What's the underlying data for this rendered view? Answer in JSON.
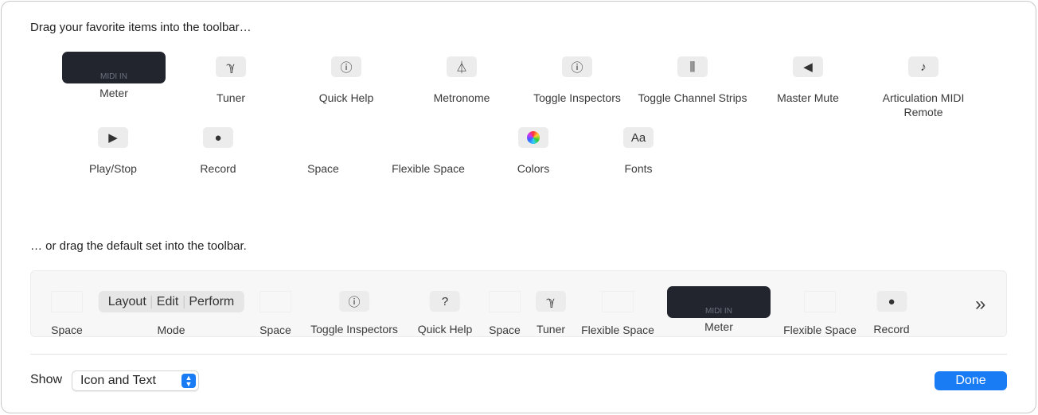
{
  "palette": {
    "heading": "Drag your favorite items into the toolbar…",
    "row1": [
      {
        "label": "Meter",
        "icon": "meter",
        "sub": "MIDI IN"
      },
      {
        "label": "Tuner",
        "icon": "tuning-fork-icon",
        "glyph": "ℽ"
      },
      {
        "label": "Quick Help",
        "icon": "question-circle-icon",
        "glyph": "ⓘ"
      },
      {
        "label": "Metronome",
        "icon": "metronome-icon",
        "glyph": "⏃"
      },
      {
        "label": "Toggle Inspectors",
        "icon": "info-circle-icon",
        "glyph": "ⓘ"
      },
      {
        "label": "Toggle Channel Strips",
        "icon": "sliders-icon",
        "glyph": "⫼"
      },
      {
        "label": "Master Mute",
        "icon": "speaker-icon",
        "glyph": "◀"
      },
      {
        "label": "Articulation MIDI Remote",
        "icon": "articulation-icon",
        "glyph": "♪"
      }
    ],
    "row2": [
      {
        "label": "Play/Stop",
        "icon": "play-icon",
        "glyph": "▶"
      },
      {
        "label": "Record",
        "icon": "record-icon",
        "glyph": "●"
      },
      {
        "label": "Space",
        "icon": "space"
      },
      {
        "label": "Flexible Space",
        "icon": "flexible-space"
      },
      {
        "label": "Colors",
        "icon": "color-wheel-icon"
      },
      {
        "label": "Fonts",
        "icon": "fonts-icon",
        "glyph": "Aa"
      }
    ]
  },
  "default_set": {
    "heading": "… or drag the default set into the toolbar.",
    "items": [
      {
        "label": "Space"
      },
      {
        "label": "Mode",
        "segments": [
          "Layout",
          "Edit",
          "Perform"
        ]
      },
      {
        "label": "Space"
      },
      {
        "label": "Toggle Inspectors",
        "glyph": "ⓘ"
      },
      {
        "label": "Quick Help",
        "glyph": "?"
      },
      {
        "label": "Space"
      },
      {
        "label": "Tuner",
        "glyph": "ℽ"
      },
      {
        "label": "Flexible Space"
      },
      {
        "label": "Meter",
        "sub": "MIDI IN"
      },
      {
        "label": "Flexible Space"
      },
      {
        "label": "Record",
        "glyph": "●"
      }
    ],
    "overflow": "»"
  },
  "footer": {
    "show_label": "Show",
    "show_value": "Icon and Text",
    "done": "Done"
  },
  "colors": {
    "accent": "#1a7cf5",
    "meter_bg": "#22252d"
  }
}
